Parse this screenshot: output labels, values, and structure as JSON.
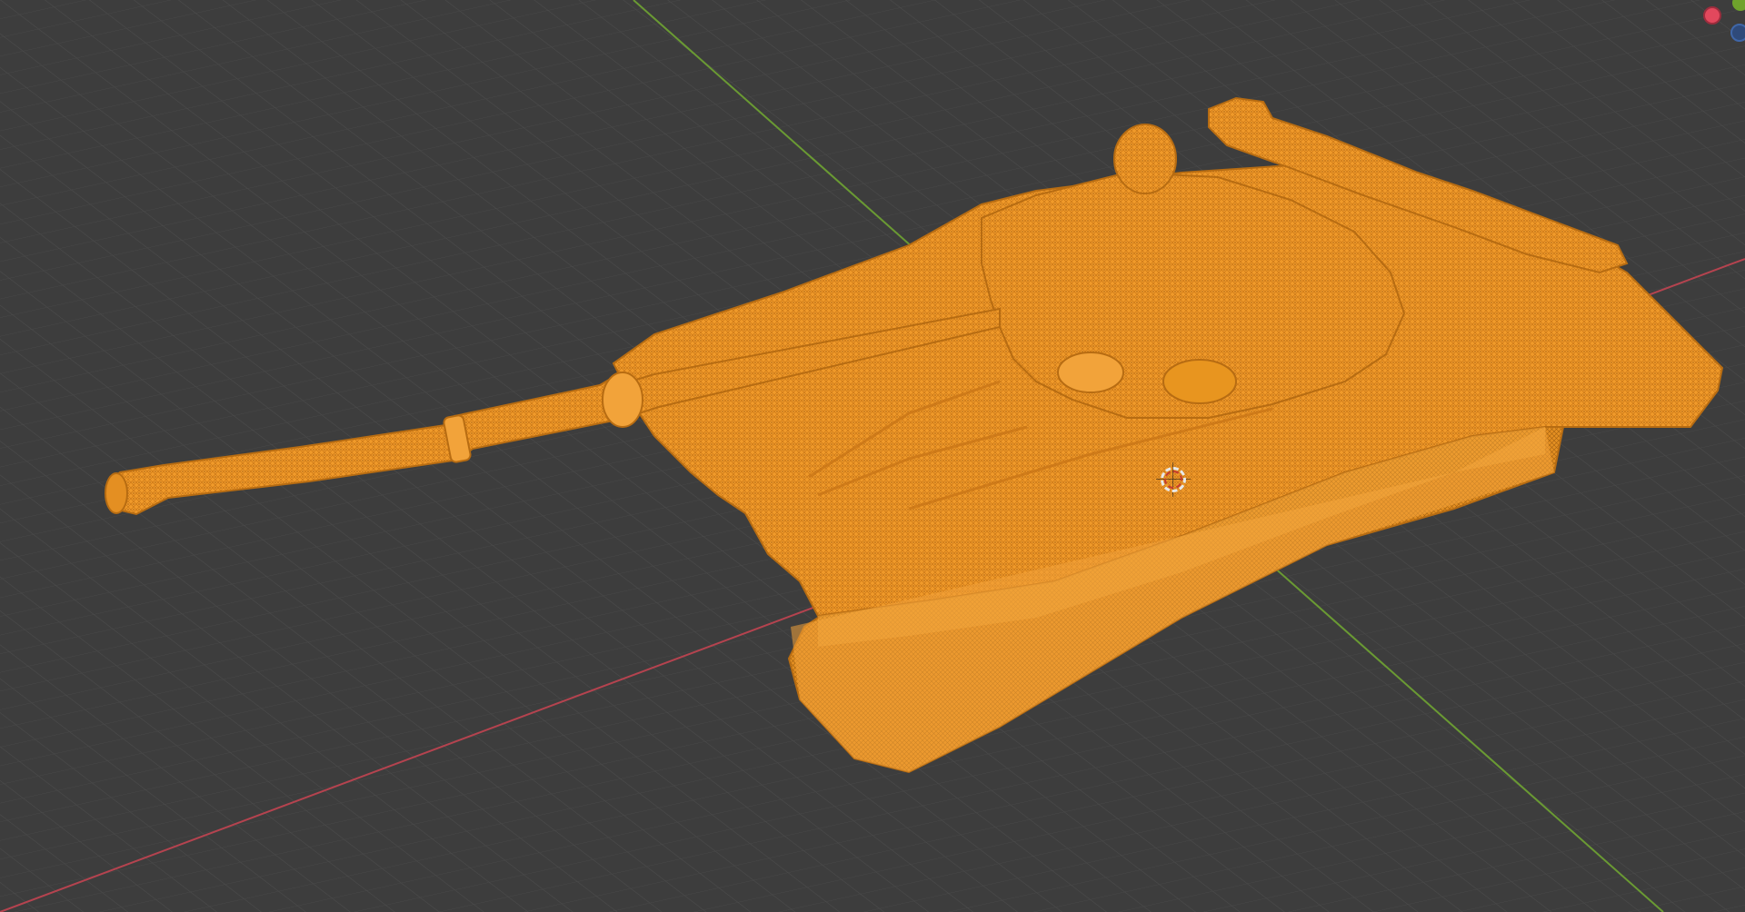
{
  "viewport": {
    "background_color": "#3d3d3d",
    "grid_color": "#4a4a4a",
    "x_axis_color": "#b5434f",
    "y_axis_color": "#6a9a33"
  },
  "object": {
    "name": "",
    "color": "#f09a2a",
    "wire_color": "#c97616",
    "display": "wireframe-mesh-selected"
  },
  "navigation_gizmo": {
    "x_label": "",
    "x_color": "#e2485d",
    "y_color": "#6fa32c",
    "z_color": "#3f66a8"
  },
  "cursor_3d": {
    "icon": "3d-cursor-icon"
  }
}
